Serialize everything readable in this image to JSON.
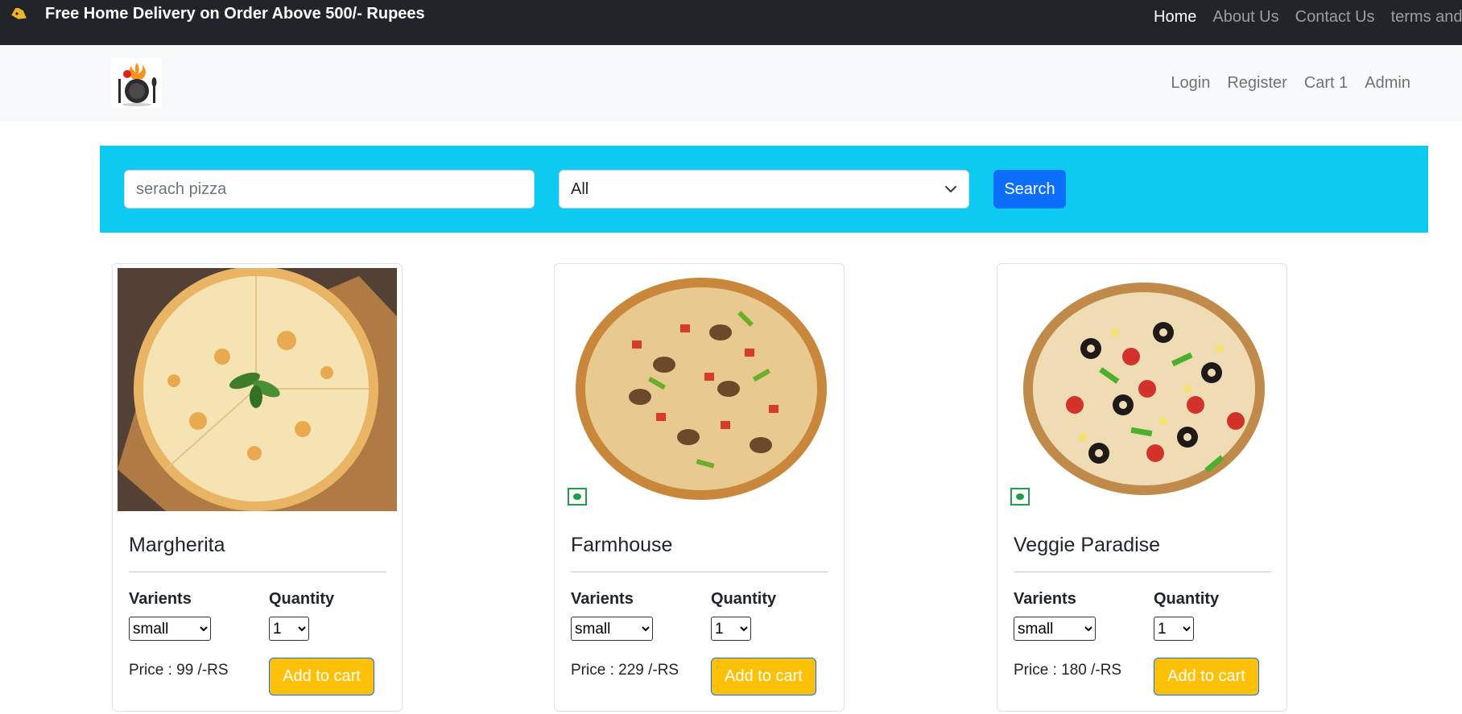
{
  "topbar": {
    "promo": "Free Home Delivery on Order Above 500/- Rupees",
    "links": [
      "Home",
      "About Us",
      "Contact Us",
      "terms and"
    ]
  },
  "navbar": {
    "links": [
      "Login",
      "Register",
      "Cart 1",
      "Admin"
    ]
  },
  "search": {
    "placeholder": "serach pizza",
    "filter_value": "All",
    "button_label": "Search"
  },
  "products": [
    {
      "name": "Margherita",
      "variants_label": "Varients",
      "quantity_label": "Quantity",
      "variant": "small",
      "quantity": "1",
      "price": "Price : 99 /-RS",
      "button": "Add to cart"
    },
    {
      "name": "Farmhouse",
      "variants_label": "Varients",
      "quantity_label": "Quantity",
      "variant": "small",
      "quantity": "1",
      "price": "Price : 229 /-RS",
      "button": "Add to cart"
    },
    {
      "name": "Veggie Paradise",
      "variants_label": "Varients",
      "quantity_label": "Quantity",
      "variant": "small",
      "quantity": "1",
      "price": "Price : 180 /-RS",
      "button": "Add to cart"
    }
  ],
  "colors": {
    "topbar_bg": "#212529",
    "navbar_bg": "#f8f9fa",
    "search_panel_bg": "#0dcaf0",
    "search_button_bg": "#0d6efd",
    "add_to_cart_bg": "#ffc107",
    "veg_mark": "#1e9e4a"
  }
}
